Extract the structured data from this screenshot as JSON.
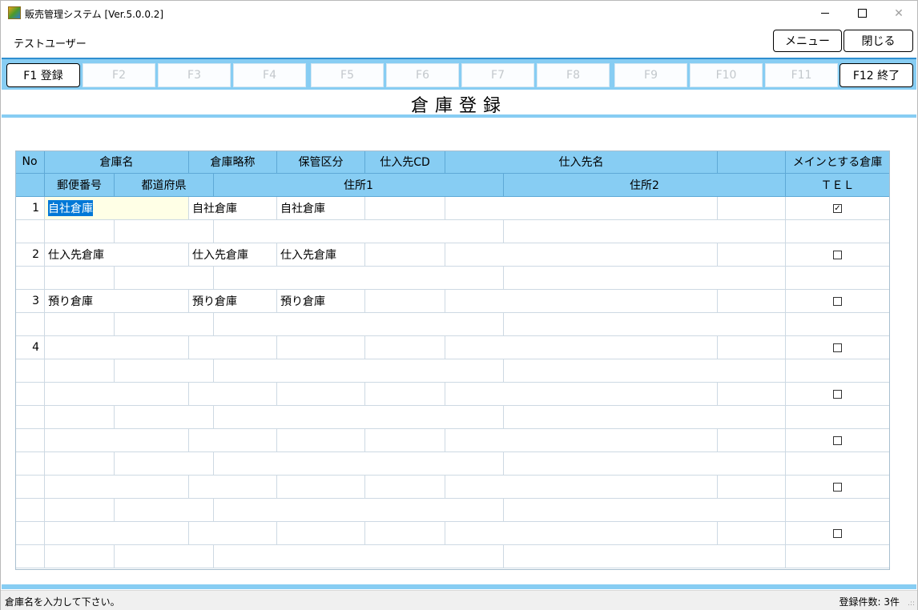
{
  "window": {
    "title": "販売管理システム [Ver.5.0.0.2]",
    "icons": {
      "app": "app-icon",
      "minimize": "minimize-icon",
      "maximize": "maximize-icon",
      "close": "close-icon"
    },
    "close_glyph": "✕"
  },
  "userbar": {
    "user_name": "テストユーザー",
    "menu_label": "メニュー",
    "close_label": "閉じる"
  },
  "fkeys": [
    {
      "label": "F1 登録",
      "enabled": true
    },
    {
      "label": "F2",
      "enabled": false
    },
    {
      "label": "F3",
      "enabled": false
    },
    {
      "label": "F4",
      "enabled": false
    },
    {
      "label": "F5",
      "enabled": false
    },
    {
      "label": "F6",
      "enabled": false
    },
    {
      "label": "F7",
      "enabled": false
    },
    {
      "label": "F8",
      "enabled": false
    },
    {
      "label": "F9",
      "enabled": false
    },
    {
      "label": "F10",
      "enabled": false
    },
    {
      "label": "F11",
      "enabled": false
    },
    {
      "label": "F12 終了",
      "enabled": true
    }
  ],
  "page": {
    "title": "倉庫登録"
  },
  "grid": {
    "header_row1": [
      "No",
      "倉庫名",
      "倉庫略称",
      "保管区分",
      "仕入先CD",
      "仕入先名",
      "",
      "メインとする倉庫"
    ],
    "header_row2": [
      "",
      "郵便番号",
      "都道府県",
      "住所1",
      "住所2",
      "ＴＥＬ"
    ],
    "records": [
      {
        "no": "1",
        "name": "自社倉庫",
        "short": "自社倉庫",
        "storage": "自社倉庫",
        "supplier_cd": "",
        "supplier_name": "",
        "extra": "",
        "main": true,
        "postal": "",
        "pref": "",
        "addr1": "",
        "addr2": "",
        "tel": ""
      },
      {
        "no": "2",
        "name": "仕入先倉庫",
        "short": "仕入先倉庫",
        "storage": "仕入先倉庫",
        "supplier_cd": "",
        "supplier_name": "",
        "extra": "",
        "main": false,
        "postal": "",
        "pref": "",
        "addr1": "",
        "addr2": "",
        "tel": ""
      },
      {
        "no": "3",
        "name": "預り倉庫",
        "short": "預り倉庫",
        "storage": "預り倉庫",
        "supplier_cd": "",
        "supplier_name": "",
        "extra": "",
        "main": false,
        "postal": "",
        "pref": "",
        "addr1": "",
        "addr2": "",
        "tel": ""
      },
      {
        "no": "4",
        "name": "",
        "short": "",
        "storage": "",
        "supplier_cd": "",
        "supplier_name": "",
        "extra": "",
        "main": false,
        "postal": "",
        "pref": "",
        "addr1": "",
        "addr2": "",
        "tel": ""
      },
      {
        "no": "",
        "name": "",
        "short": "",
        "storage": "",
        "supplier_cd": "",
        "supplier_name": "",
        "extra": "",
        "main": false,
        "postal": "",
        "pref": "",
        "addr1": "",
        "addr2": "",
        "tel": ""
      },
      {
        "no": "",
        "name": "",
        "short": "",
        "storage": "",
        "supplier_cd": "",
        "supplier_name": "",
        "extra": "",
        "main": false,
        "postal": "",
        "pref": "",
        "addr1": "",
        "addr2": "",
        "tel": ""
      },
      {
        "no": "",
        "name": "",
        "short": "",
        "storage": "",
        "supplier_cd": "",
        "supplier_name": "",
        "extra": "",
        "main": false,
        "postal": "",
        "pref": "",
        "addr1": "",
        "addr2": "",
        "tel": ""
      },
      {
        "no": "",
        "name": "",
        "short": "",
        "storage": "",
        "supplier_cd": "",
        "supplier_name": "",
        "extra": "",
        "main": false,
        "postal": "",
        "pref": "",
        "addr1": "",
        "addr2": "",
        "tel": ""
      }
    ],
    "focused_record": 0,
    "check_glyph": "✓"
  },
  "status": {
    "message": "倉庫名を入力して下さい。",
    "count": "登録件数: 3件",
    "grip": ".::"
  },
  "colors": {
    "accent": "#87cdf3",
    "accent_dark": "#2f8fd0",
    "selection": "#0078d7",
    "focus_bg": "#ffffe6"
  }
}
